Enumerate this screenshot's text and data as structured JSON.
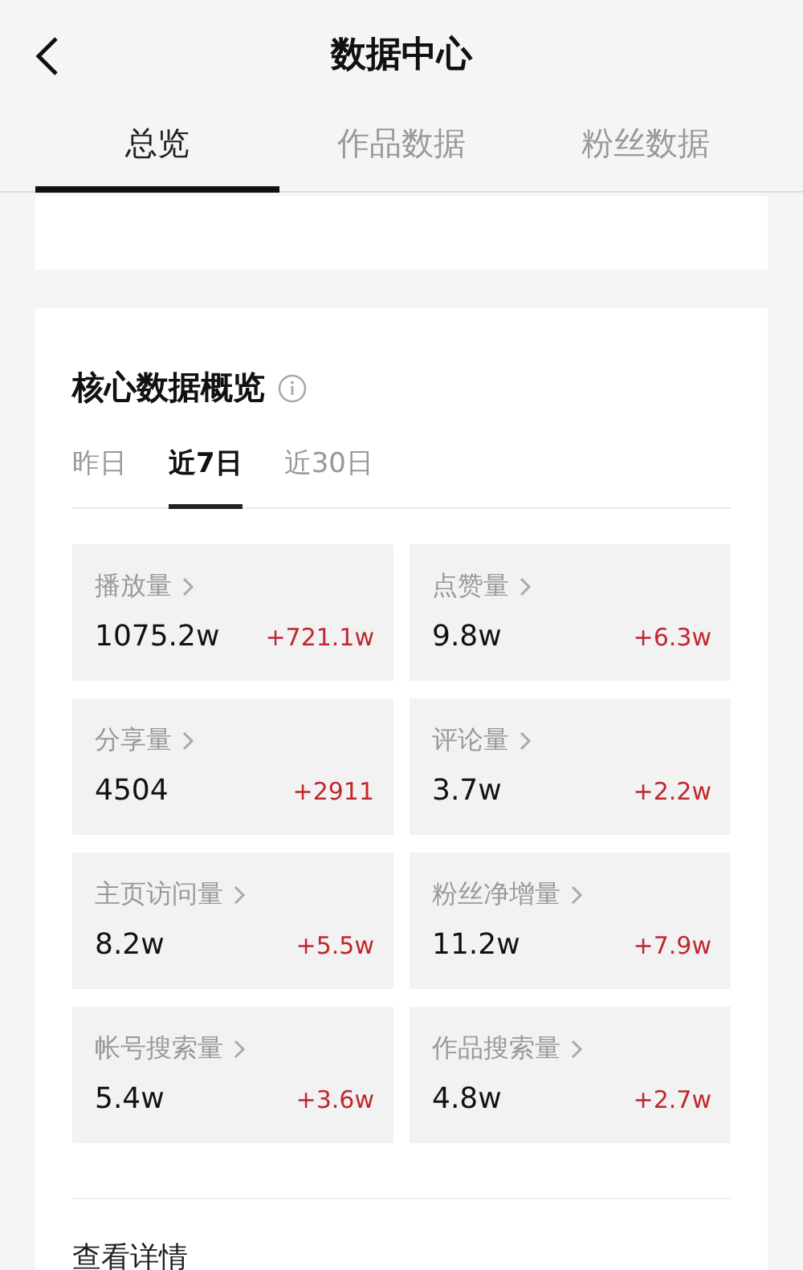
{
  "header": {
    "title": "数据中心"
  },
  "tabs": [
    {
      "label": "总览",
      "selected": true
    },
    {
      "label": "作品数据",
      "selected": false
    },
    {
      "label": "粉丝数据",
      "selected": false
    }
  ],
  "overview": {
    "title": "核心数据概览",
    "periods": [
      {
        "label": "昨日",
        "selected": false
      },
      {
        "label": "近7日",
        "selected": true
      },
      {
        "label": "近30日",
        "selected": false
      }
    ],
    "metrics": [
      {
        "label": "播放量",
        "value": "1075.2w",
        "change": "+721.1w"
      },
      {
        "label": "点赞量",
        "value": "9.8w",
        "change": "+6.3w"
      },
      {
        "label": "分享量",
        "value": "4504",
        "change": "+2911"
      },
      {
        "label": "评论量",
        "value": "3.7w",
        "change": "+2.2w"
      },
      {
        "label": "主页访问量",
        "value": "8.2w",
        "change": "+5.5w"
      },
      {
        "label": "粉丝净增量",
        "value": "11.2w",
        "change": "+7.9w"
      },
      {
        "label": "帐号搜索量",
        "value": "5.4w",
        "change": "+3.6w"
      },
      {
        "label": "作品搜索量",
        "value": "4.8w",
        "change": "+2.7w"
      }
    ],
    "details_link": "查看详情"
  }
}
